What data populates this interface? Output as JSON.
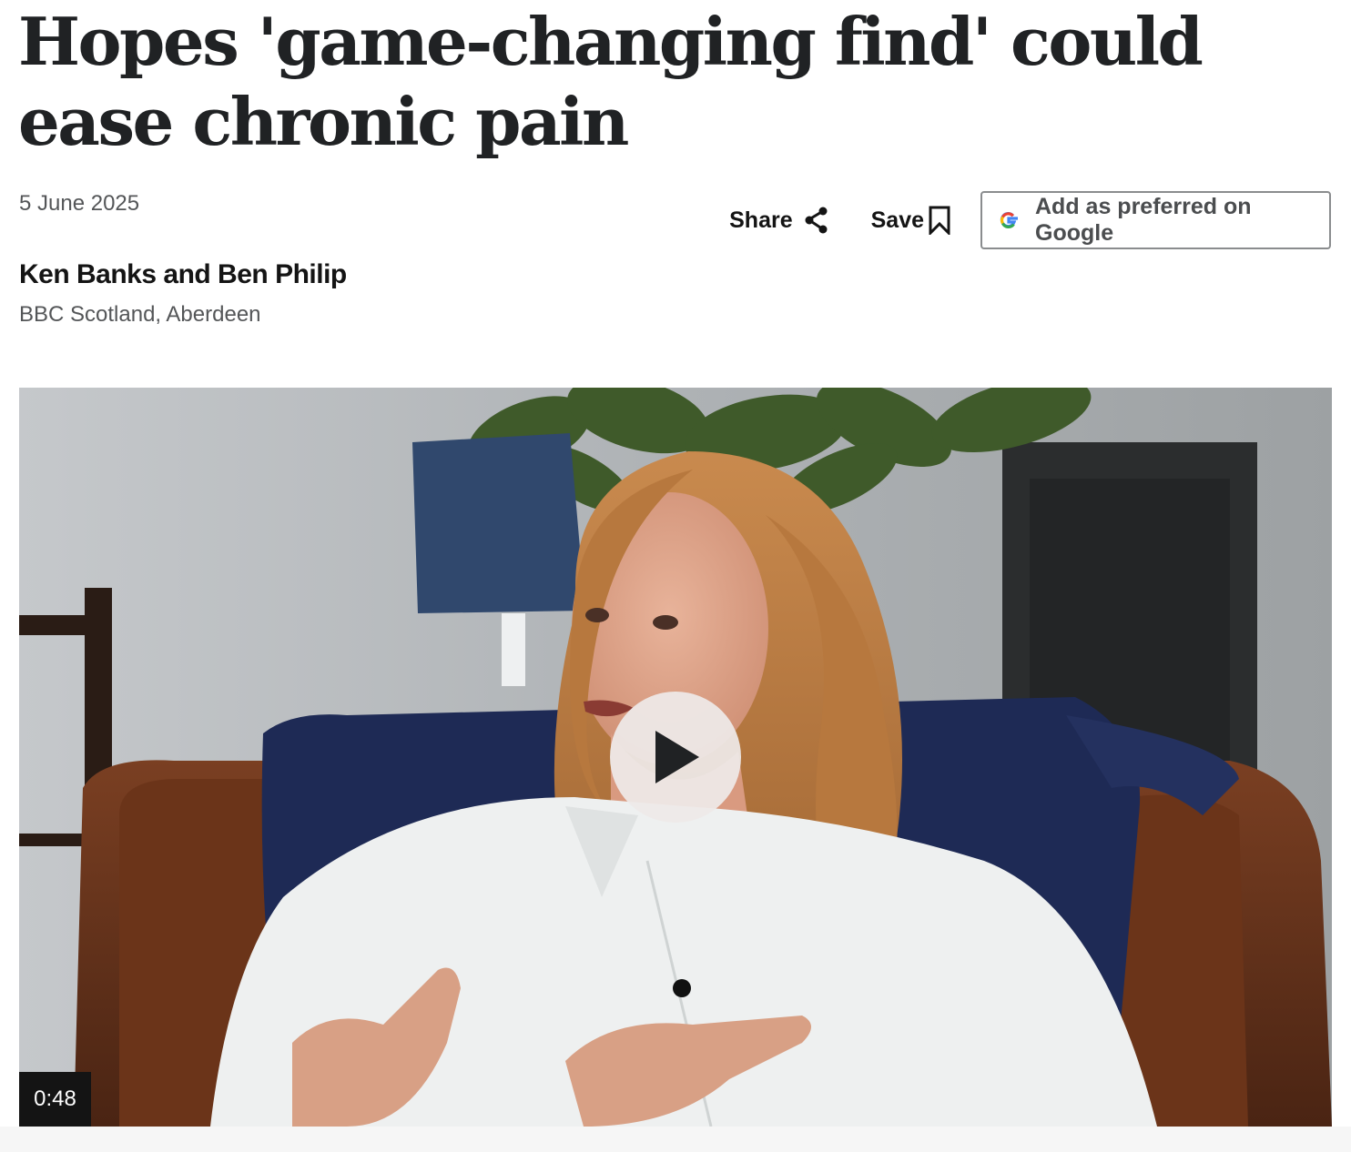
{
  "article": {
    "headline": "Hopes 'game-changing find' could ease chronic pain",
    "date": "5 June 2025",
    "byline": {
      "authors": "Ken Banks and Ben Philip",
      "role": "BBC Scotland, Aberdeen"
    }
  },
  "actions": {
    "share_label": "Share",
    "save_label": "Save",
    "google_label": "Add as preferred on Google"
  },
  "media": {
    "duration": "0:48"
  },
  "icons": {
    "share": "share-icon",
    "save": "bookmark-icon",
    "google": "google-g-icon",
    "play": "play-icon"
  },
  "colors": {
    "headline": "#202224",
    "muted_text": "#545658",
    "button_border": "#8a8c8e",
    "duration_badge": "#141414",
    "play_button": "#eeeae8"
  }
}
